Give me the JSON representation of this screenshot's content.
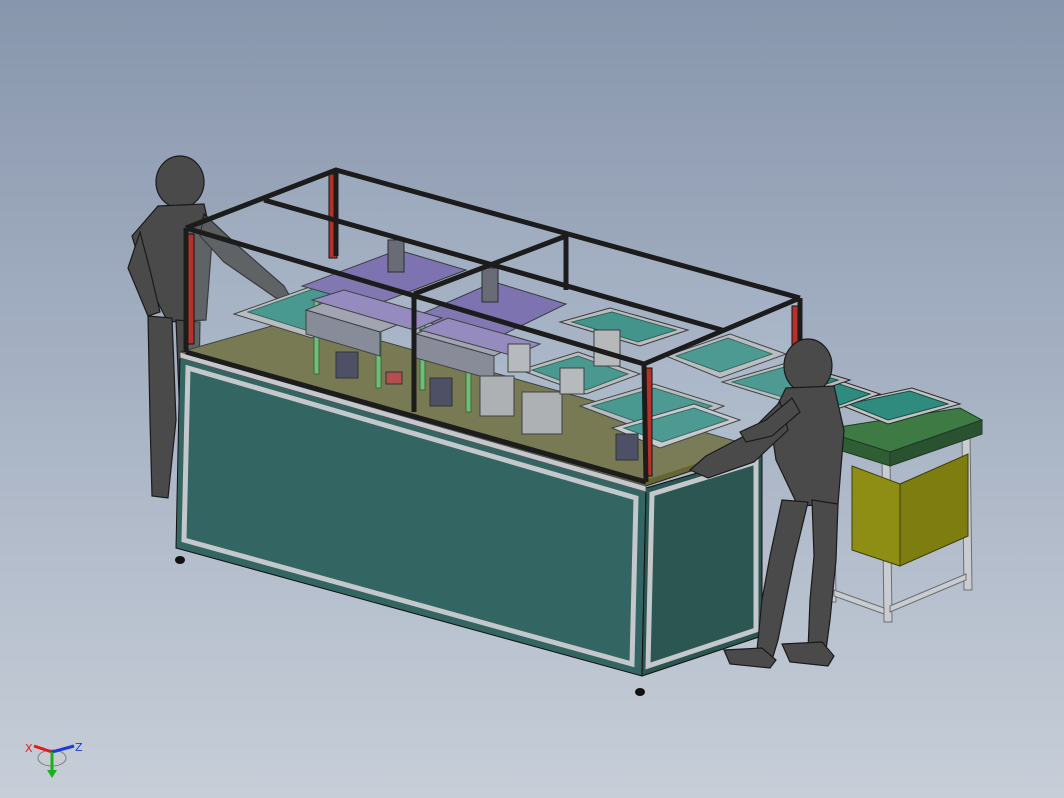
{
  "viewport": {
    "background_top": "#8896ad",
    "background_bottom": "#c7ced8"
  },
  "colors": {
    "panel_front": "#336662",
    "panel_side": "#2c5652",
    "tabletop": "#666633",
    "frame": "#1c1c1c",
    "post_red": "#b5322b",
    "purple_plate": "#7263a8",
    "green_board": "#2e8b7e",
    "mannequin": "#4a4a4a",
    "bin_yellow": "#8c8c17",
    "conveyor_green": "#3e7a44",
    "leg_grey": "#bfc3c8"
  },
  "triad": {
    "x_label": "X",
    "z_label": "Z",
    "x_color": "#e11b1b",
    "z_color": "#1b3ae1",
    "y_color": "#1bb11b"
  }
}
